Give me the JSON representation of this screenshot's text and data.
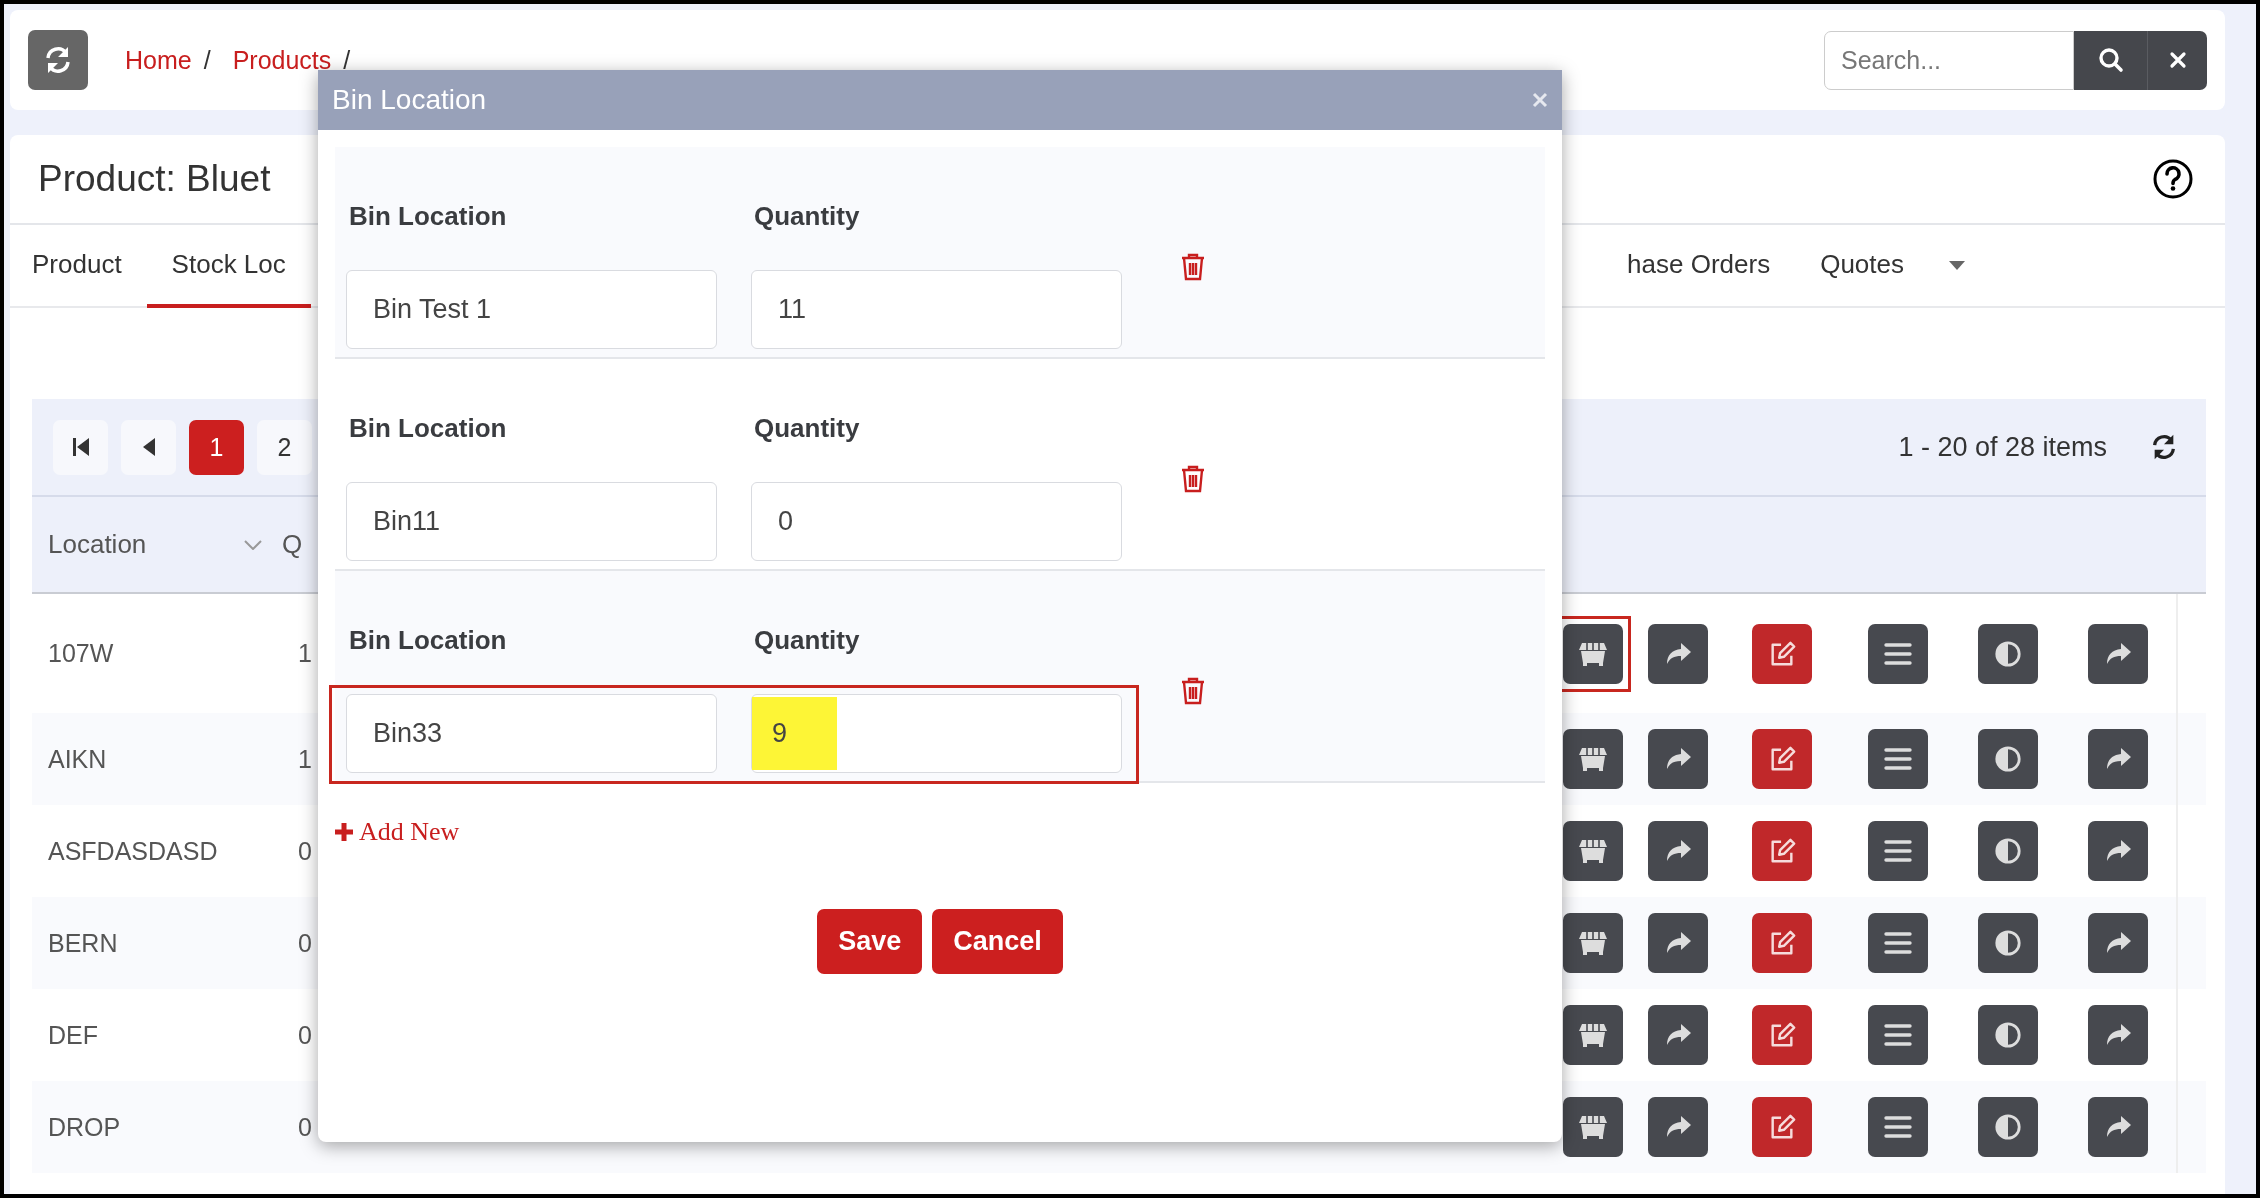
{
  "toolbar": {
    "breadcrumb": [
      {
        "label": "Home",
        "separator": "/"
      },
      {
        "label": "Products",
        "separator": "/"
      }
    ],
    "search": {
      "placeholder": "Search..."
    }
  },
  "product": {
    "title": "Product: Bluet",
    "tabs": [
      {
        "label": "Product",
        "selected": false
      },
      {
        "label": "Stock Loc",
        "selected": true
      }
    ],
    "more_tabs": [
      {
        "label": "hase Orders",
        "selected": false
      },
      {
        "label": "Quotes",
        "selected": false
      }
    ]
  },
  "grid": {
    "pager": [
      {
        "label": "1",
        "selected": true
      },
      {
        "label": "2",
        "selected": false
      }
    ],
    "summary": "1 - 20 of 28 items",
    "columns": [
      "Location",
      "Q"
    ],
    "action_buttons": [
      {
        "kind": "dumpster"
      },
      {
        "kind": "share"
      },
      {
        "kind": "edit"
      },
      {
        "kind": "list"
      },
      {
        "kind": "contrast"
      },
      {
        "kind": "share"
      }
    ],
    "rows": [
      {
        "location": "107W",
        "column_2": "1",
        "highlighted": true
      },
      {
        "location": "AIKN",
        "column_2": "1",
        "highlighted": false
      },
      {
        "location": "ASFDASDASD",
        "column_2": "0",
        "highlighted": false
      },
      {
        "location": "BERN",
        "column_2": "0",
        "highlighted": false
      },
      {
        "location": "DEF",
        "column_2": "0",
        "highlighted": false
      },
      {
        "location": "DROP",
        "column_2": "0",
        "highlighted": false
      }
    ]
  },
  "dialog": {
    "title": "Bin Location",
    "bins": [
      {
        "bin_label": "Bin Location",
        "bin": "Bin Test 1",
        "quantity_label": "Quantity",
        "quantity": "11",
        "outlined": false,
        "marked": false
      },
      {
        "bin_label": "Bin Location",
        "bin": "Bin11",
        "quantity_label": "Quantity",
        "quantity": "0",
        "outlined": false,
        "marked": false
      },
      {
        "bin_label": "Bin Location",
        "bin": "Bin33",
        "quantity_label": "Quantity",
        "quantity": "9",
        "outlined": true,
        "marked": true
      }
    ],
    "add_new": "Add New",
    "buttons": [
      {
        "label": "Save"
      },
      {
        "label": "Cancel"
      }
    ]
  }
}
